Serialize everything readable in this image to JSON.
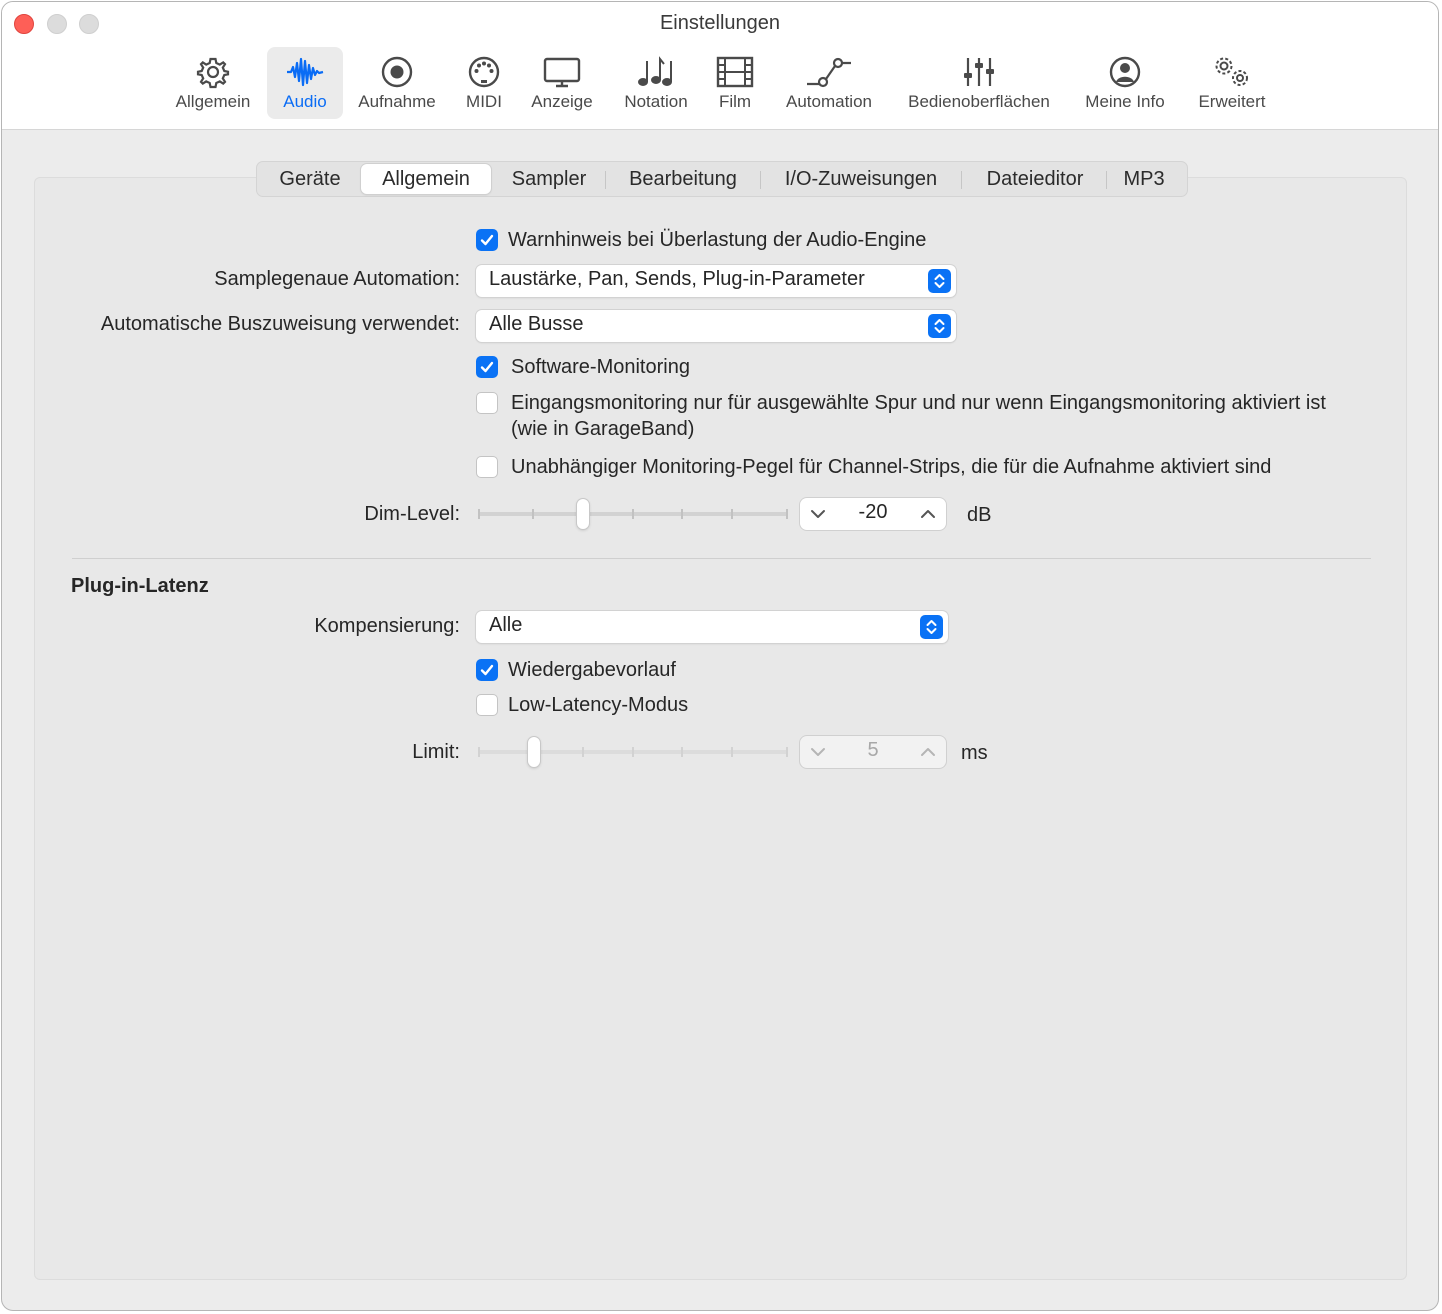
{
  "window": {
    "title": "Einstellungen"
  },
  "toolbar": {
    "items": [
      {
        "label": "Allgemein",
        "icon": "gear-icon"
      },
      {
        "label": "Audio",
        "icon": "waveform-icon"
      },
      {
        "label": "Aufnahme",
        "icon": "record-icon"
      },
      {
        "label": "MIDI",
        "icon": "midi-connector-icon"
      },
      {
        "label": "Anzeige",
        "icon": "display-icon"
      },
      {
        "label": "Notation",
        "icon": "music-notes-icon"
      },
      {
        "label": "Film",
        "icon": "film-icon"
      },
      {
        "label": "Automation",
        "icon": "automation-curve-icon"
      },
      {
        "label": "Bedienoberflächen",
        "icon": "faders-icon"
      },
      {
        "label": "Meine Info",
        "icon": "person-icon"
      },
      {
        "label": "Erweitert",
        "icon": "gears-icon"
      }
    ],
    "selected": "Audio",
    "accent_color": "#0A6CF5"
  },
  "tabs": {
    "items": [
      "Geräte",
      "Allgemein",
      "Sampler",
      "Bearbeitung",
      "I/O-Zuweisungen",
      "Dateieditor",
      "MP3"
    ],
    "selected": "Allgemein"
  },
  "general": {
    "overload_warning": {
      "label": "Warnhinweis bei Überlastung der Audio-Engine",
      "checked": true
    },
    "sample_accurate": {
      "label": "Samplegenaue Automation:",
      "value": "Laustärke, Pan, Sends, Plug-in-Parameter"
    },
    "auto_bus": {
      "label": "Automatische Buszuweisung verwendet:",
      "value": "Alle Busse"
    },
    "software_monitoring": {
      "label": "Software-Monitoring",
      "checked": true
    },
    "input_monitoring": {
      "label_line1": "Eingangsmonitoring nur für ausgewählte Spur und nur wenn Eingangsmonitoring aktiviert ist",
      "label_line2": "(wie in GarageBand)",
      "checked": false
    },
    "independent_level": {
      "label": "Unabhängiger Monitoring-Pegel für Channel-Strips, die für die Aufnahme aktiviert sind",
      "checked": false
    },
    "dim_level": {
      "label": "Dim-Level:",
      "value": "-20",
      "unit": "dB",
      "slider_fraction": 0.34
    }
  },
  "plugin_latency": {
    "heading": "Plug-in-Latenz",
    "compensation": {
      "label": "Kompensierung:",
      "value": "Alle"
    },
    "playback_preroll": {
      "label": "Wiedergabevorlauf",
      "checked": true
    },
    "low_latency": {
      "label": "Low-Latency-Modus",
      "checked": false
    },
    "limit": {
      "label": "Limit:",
      "value": "5",
      "unit": "ms",
      "slider_fraction": 0.18,
      "enabled": false
    }
  }
}
